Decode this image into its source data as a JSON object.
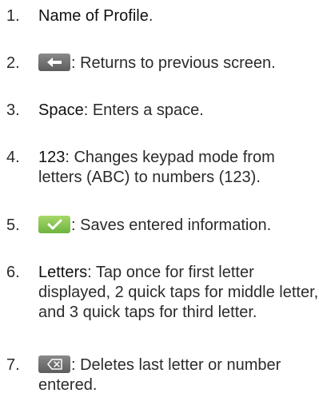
{
  "items": [
    {
      "number": "1.",
      "term": "Name of Profile",
      "desc": "."
    },
    {
      "number": "2.",
      "term": "",
      "desc": ": Returns to previous screen.",
      "icon": "back-arrow-icon"
    },
    {
      "number": "3.",
      "term": "Space",
      "desc": ": Enters a space."
    },
    {
      "number": "4.",
      "term": "123",
      "desc": ": Changes keypad mode from letters (ABC) to numbers (123)."
    },
    {
      "number": "5.",
      "term": "",
      "desc": ": Saves entered information.",
      "icon": "checkmark-icon"
    },
    {
      "number": "6.",
      "term": "Letters",
      "desc": ": Tap once for first letter displayed, 2 quick taps for middle letter, and 3 quick taps for third letter."
    },
    {
      "number": "7.",
      "term": "",
      "desc": ": Deletes last letter or number entered.",
      "icon": "backspace-icon"
    }
  ],
  "colors": {
    "text": "#2b2b2b",
    "gray_key": "#6e6e6e",
    "green_key": "#7cc04a"
  }
}
